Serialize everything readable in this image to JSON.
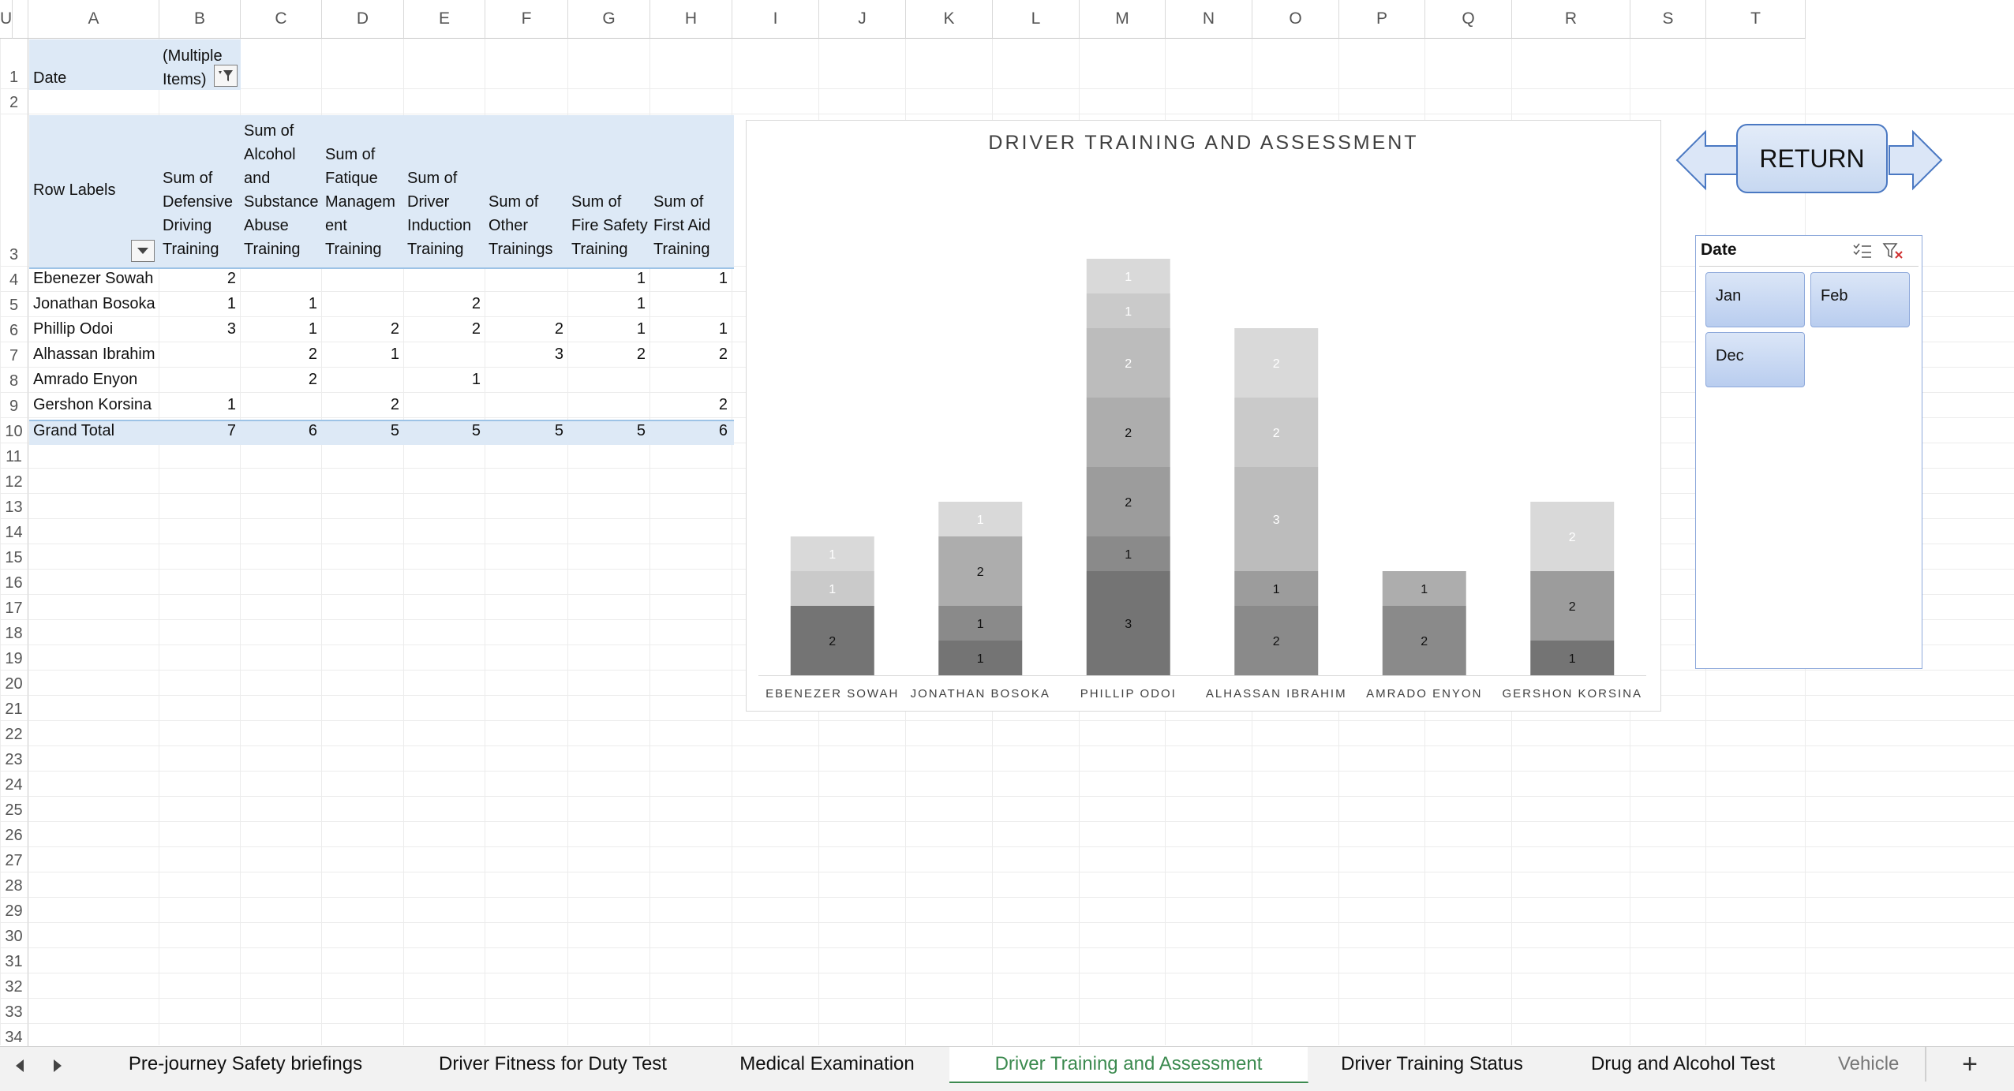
{
  "columns": [
    "A",
    "B",
    "C",
    "D",
    "E",
    "F",
    "G",
    "H",
    "I",
    "J",
    "K",
    "L",
    "M",
    "N",
    "O",
    "P",
    "Q",
    "R",
    "S",
    "T",
    "U"
  ],
  "rows": [
    "1",
    "2",
    "3",
    "4",
    "5",
    "6",
    "7",
    "8",
    "9",
    "10",
    "11",
    "12",
    "13",
    "14",
    "15",
    "16",
    "17",
    "18",
    "19",
    "20",
    "21",
    "22",
    "23",
    "24",
    "25",
    "26",
    "27",
    "28",
    "29",
    "30",
    "31",
    "32",
    "33",
    "34"
  ],
  "pivot": {
    "filter_label": "Date",
    "filter_value_line1": "(Multiple",
    "filter_value_line2": "Items)",
    "row_labels_header": "Row Labels",
    "headers": [
      [
        "Sum of",
        "Defensive",
        "Driving",
        "Training"
      ],
      [
        "Sum of",
        "Alcohol",
        "and",
        "Substance",
        "Abuse",
        "Training"
      ],
      [
        "Sum of",
        "Fatique",
        "Managem",
        "ent",
        "Training"
      ],
      [
        "Sum of",
        "Driver",
        "Induction",
        "Training"
      ],
      [
        "Sum of",
        "Other",
        "Trainings"
      ],
      [
        "Sum of",
        "Fire Safety",
        "Training"
      ],
      [
        "Sum of",
        "First Aid",
        "Training"
      ]
    ],
    "data_rows": [
      {
        "name": "Ebenezer Sowah",
        "values": [
          "2",
          "",
          "",
          "",
          "",
          "1",
          "1"
        ]
      },
      {
        "name": "Jonathan Bosoka",
        "values": [
          "1",
          "1",
          "",
          "2",
          "",
          "1",
          ""
        ]
      },
      {
        "name": "Phillip Odoi",
        "values": [
          "3",
          "1",
          "2",
          "2",
          "2",
          "1",
          "1"
        ]
      },
      {
        "name": "Alhassan Ibrahim",
        "values": [
          "",
          "2",
          "1",
          "",
          "3",
          "2",
          "2"
        ]
      },
      {
        "name": "Amrado Enyon",
        "values": [
          "",
          "2",
          "",
          "1",
          "",
          "",
          ""
        ]
      },
      {
        "name": "Gershon Korsina",
        "values": [
          "1",
          "",
          "2",
          "",
          "",
          "",
          "2"
        ]
      }
    ],
    "total_label": "Grand Total",
    "totals": [
      "7",
      "6",
      "5",
      "5",
      "5",
      "5",
      "6"
    ]
  },
  "chart_data": {
    "type": "bar",
    "stacked": true,
    "title": "DRIVER TRAINING AND ASSESSMENT",
    "categories": [
      "EBENEZER SOWAH",
      "JONATHAN BOSOKA",
      "PHILLIP ODOI",
      "ALHASSAN IBRAHIM",
      "AMRADO ENYON",
      "GERSHON KORSINA"
    ],
    "series": [
      {
        "values": [
          2,
          1,
          3,
          0,
          0,
          1
        ],
        "color": "#747474"
      },
      {
        "values": [
          0,
          1,
          1,
          2,
          2,
          0
        ],
        "color": "#8a8a8a"
      },
      {
        "values": [
          0,
          0,
          2,
          1,
          0,
          2
        ],
        "color": "#9c9c9c"
      },
      {
        "values": [
          0,
          2,
          2,
          0,
          1,
          0
        ],
        "color": "#adadad"
      },
      {
        "values": [
          0,
          0,
          2,
          3,
          0,
          0
        ],
        "color": "#bcbcbc"
      },
      {
        "values": [
          1,
          0,
          1,
          2,
          0,
          0
        ],
        "color": "#cacaca"
      },
      {
        "values": [
          1,
          1,
          1,
          2,
          0,
          2
        ],
        "color": "#d9d9d9"
      }
    ],
    "legend": "none"
  },
  "return_button": "RETURN",
  "slicer": {
    "title": "Date",
    "items": [
      "Jan",
      "Feb",
      "Dec"
    ]
  },
  "sheet_tabs": [
    {
      "label": "Pre-journey Safety briefings",
      "active": false
    },
    {
      "label": "Driver Fitness for Duty Test",
      "active": false
    },
    {
      "label": "Medical Examination",
      "active": false
    },
    {
      "label": "Driver Training and Assessment",
      "active": true
    },
    {
      "label": "Driver Training Status",
      "active": false
    },
    {
      "label": "Drug and Alcohol Test",
      "active": false
    },
    {
      "label": "Vehicle",
      "active": false
    }
  ],
  "colors": {
    "pivot_header_bg": "#dde9f6",
    "accent_green": "#3b8a4f",
    "slicer_blue": "#8ea9db"
  }
}
